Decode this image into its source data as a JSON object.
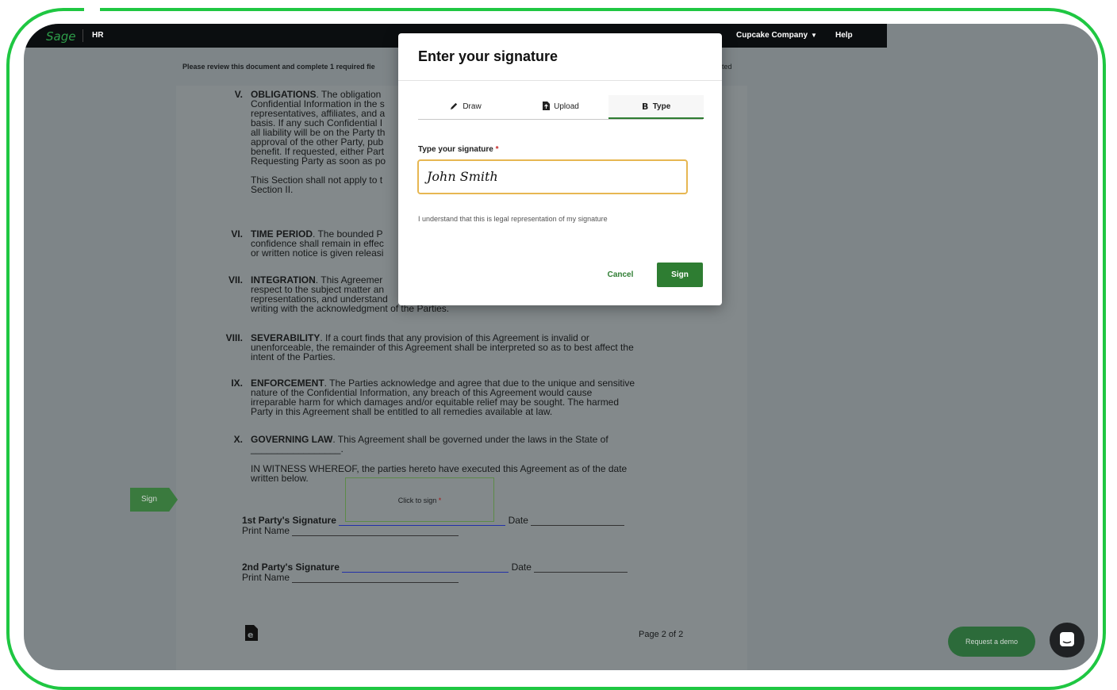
{
  "app": {
    "brand": "Sage",
    "module": "HR",
    "company": "Cupcake Company",
    "help": "Help"
  },
  "banner": {
    "text": "Please review this document and complete 1 required fie",
    "tail": "ted"
  },
  "document": {
    "sections": [
      {
        "num": "V.",
        "title": "OBLIGATIONS",
        "lines": [
          ". The obligation",
          "Confidential Information in the s",
          "representatives, affiliates, and a",
          "basis. If any such Confidential I",
          "all liability will be on the Party th",
          "approval of the other Party, pub",
          "benefit. If requested, either Part",
          "Requesting Party as soon as po"
        ],
        "extra": [
          "This Section shall not apply to t",
          "Section II."
        ]
      },
      {
        "num": "VI.",
        "title": "TIME PERIOD",
        "lines": [
          ". The bounded P",
          "confidence shall remain in effec",
          "or written notice is given releasi"
        ]
      },
      {
        "num": "VII.",
        "title": "INTEGRATION",
        "lines": [
          ". This Agreemer",
          "respect to the subject matter an",
          "representations, and understand",
          "writing with the acknowledgment of the Parties."
        ]
      },
      {
        "num": "VIII.",
        "title": "SEVERABILITY",
        "lines": [
          ". If a court finds that any provision of this Agreement is invalid or",
          "unenforceable, the remainder of this Agreement shall be interpreted so as to best affect the",
          "intent of the Parties."
        ]
      },
      {
        "num": "IX.",
        "title": "ENFORCEMENT",
        "lines": [
          ". The Parties acknowledge and agree that due to the unique and sensitive",
          "nature of the Confidential Information, any breach of this Agreement would cause",
          "irreparable harm for which damages and/or equitable relief may be sought. The harmed",
          "Party in this Agreement shall be entitled to all remedies available at law."
        ]
      },
      {
        "num": "X.",
        "title": "GOVERNING LAW",
        "lines": [
          ". This Agreement shall be governed under the laws in the State of",
          "_________________."
        ],
        "extra": [
          "IN WITNESS WHEREOF, the parties hereto have executed this Agreement as of the date",
          "written below."
        ]
      }
    ],
    "party1_label": "1st Party's Signature",
    "party2_label": "2nd Party's Signature",
    "date_label": "Date",
    "print_name_label": "Print Name",
    "click_to_sign": "Click to sign",
    "req_mark": "*",
    "side_sign": "Sign",
    "page_num": "Page 2 of 2"
  },
  "modal": {
    "title": "Enter your signature",
    "tabs": [
      {
        "label": "Draw",
        "icon": "pencil-icon"
      },
      {
        "label": "Upload",
        "icon": "upload-file-icon"
      },
      {
        "label": "Type",
        "icon": "bold-type-icon"
      }
    ],
    "active_tab": "Type",
    "field_label": "Type your signature",
    "req_mark": "*",
    "signature_value": "John Smith",
    "legal_note": "I understand that this is legal representation of my signature",
    "cancel": "Cancel",
    "sign": "Sign"
  },
  "footer": {
    "request_demo": "Request a demo"
  },
  "colors": {
    "frame": "#1fc742",
    "primary": "#2e7d32",
    "input_focus": "#e7b752",
    "overlay": "#7e8588"
  }
}
